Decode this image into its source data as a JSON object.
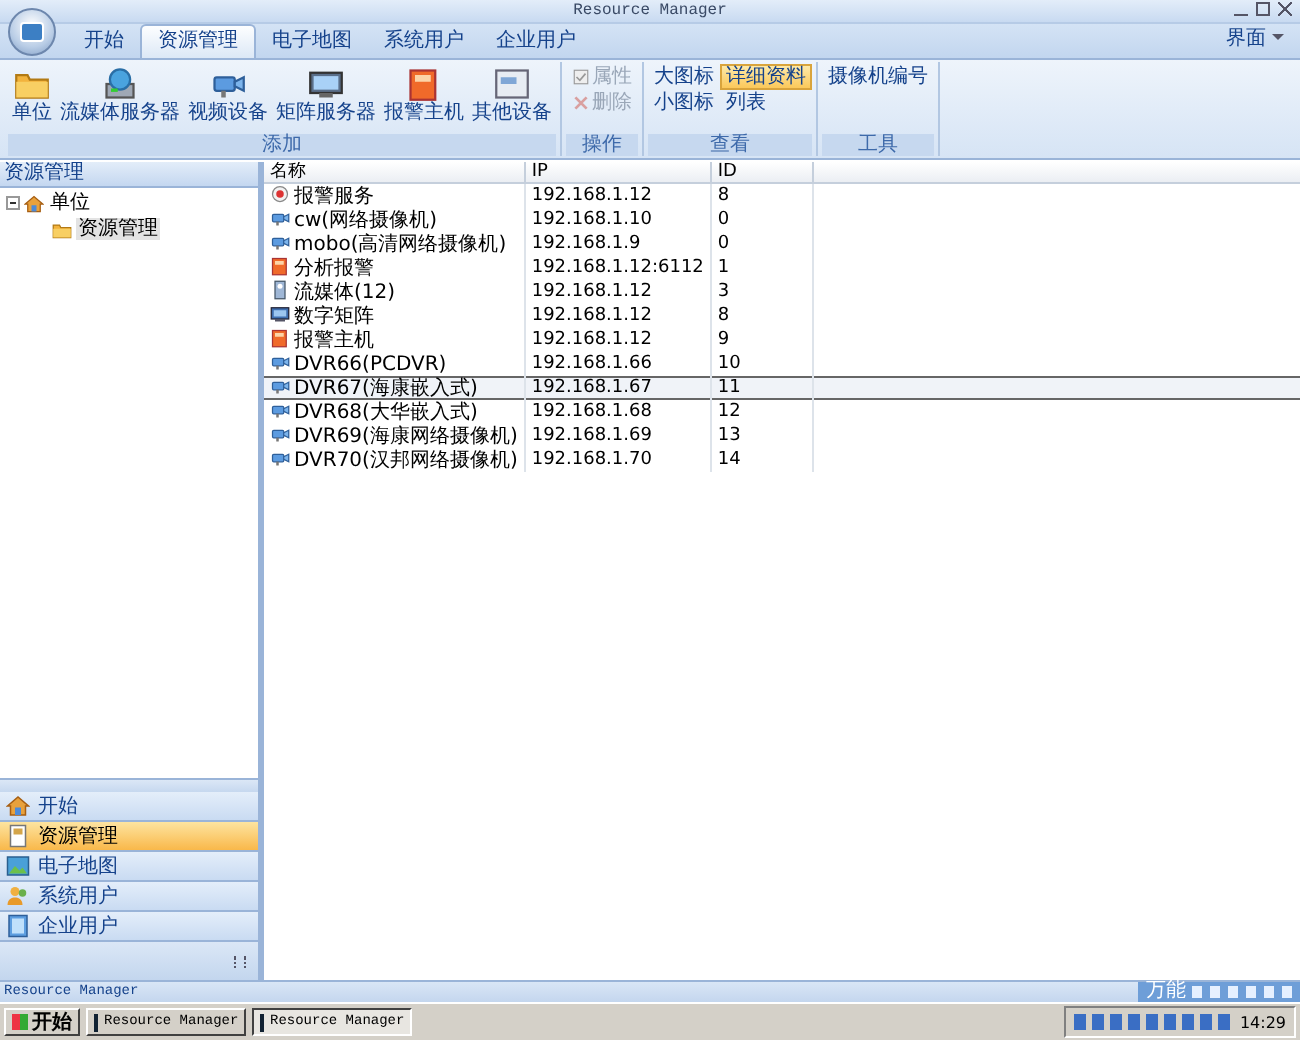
{
  "window": {
    "title": "Resource Manager"
  },
  "tabs": [
    {
      "label": "开始",
      "selected": false
    },
    {
      "label": "资源管理",
      "selected": true
    },
    {
      "label": "电子地图",
      "selected": false
    },
    {
      "label": "系统用户",
      "selected": false
    },
    {
      "label": "企业用户",
      "selected": false
    }
  ],
  "interface_menu": "界面",
  "ribbon": [
    {
      "label": "添加",
      "items": [
        {
          "label": "单位",
          "kind": "folder",
          "disabled": false,
          "selected": false
        },
        {
          "label": "流媒体服务器",
          "kind": "server",
          "disabled": false,
          "selected": false
        },
        {
          "label": "视频设备",
          "kind": "camera",
          "disabled": false,
          "selected": false
        },
        {
          "label": "矩阵服务器",
          "kind": "monitor",
          "disabled": false,
          "selected": false
        },
        {
          "label": "报警主机",
          "kind": "alarm",
          "disabled": false,
          "selected": false
        },
        {
          "label": "其他设备",
          "kind": "device",
          "disabled": false,
          "selected": false
        }
      ]
    },
    {
      "label": "操作",
      "small": [
        {
          "label": "属性",
          "kind": "check",
          "disabled": true,
          "selected": false
        },
        {
          "label": "删除",
          "kind": "cross",
          "disabled": true,
          "selected": false
        }
      ]
    },
    {
      "label": "查看",
      "small": [
        {
          "label": "大图标",
          "disabled": false,
          "selected": false
        },
        {
          "label": "详细资料",
          "disabled": false,
          "selected": true
        },
        {
          "label": "小图标",
          "disabled": false,
          "selected": false
        },
        {
          "label": "列表",
          "disabled": false,
          "selected": false
        }
      ]
    },
    {
      "label": "工具",
      "small": [
        {
          "label": "摄像机编号",
          "disabled": false,
          "selected": false
        }
      ]
    }
  ],
  "sidebar": {
    "title": "资源管理",
    "tree": [
      {
        "label": "单位",
        "kind": "home",
        "selected": false,
        "expanded": true,
        "children": [
          {
            "label": "资源管理",
            "kind": "folder",
            "selected": true
          }
        ]
      }
    ],
    "nav": [
      {
        "label": "开始",
        "kind": "home",
        "selected": false
      },
      {
        "label": "资源管理",
        "kind": "doc",
        "selected": true
      },
      {
        "label": "电子地图",
        "kind": "map",
        "selected": false
      },
      {
        "label": "系统用户",
        "kind": "users",
        "selected": false
      },
      {
        "label": "企业用户",
        "kind": "user",
        "selected": false
      }
    ]
  },
  "table": {
    "columns": [
      "名称",
      "IP",
      "ID"
    ],
    "rows": [
      {
        "kind": "alarm-service",
        "name": "报警服务",
        "ip": "192.168.1.12",
        "id": "8",
        "selected": false
      },
      {
        "kind": "camera",
        "name": "cw(网络摄像机)",
        "ip": "192.168.1.10",
        "id": "0",
        "selected": false
      },
      {
        "kind": "camera",
        "name": "mobo(高清网络摄像机)",
        "ip": "192.168.1.9",
        "id": "0",
        "selected": false
      },
      {
        "kind": "alarm",
        "name": "分析报警",
        "ip": "192.168.1.12:6112",
        "id": "1",
        "selected": false
      },
      {
        "kind": "stream",
        "name": "流媒体(12)",
        "ip": "192.168.1.12",
        "id": "3",
        "selected": false
      },
      {
        "kind": "matrix",
        "name": "数字矩阵",
        "ip": "192.168.1.12",
        "id": "8",
        "selected": false
      },
      {
        "kind": "alarm",
        "name": "报警主机",
        "ip": "192.168.1.12",
        "id": "9",
        "selected": false
      },
      {
        "kind": "camera",
        "name": "DVR66(PCDVR)",
        "ip": "192.168.1.66",
        "id": "10",
        "selected": false
      },
      {
        "kind": "camera",
        "name": "DVR67(海康嵌入式)",
        "ip": "192.168.1.67",
        "id": "11",
        "selected": true
      },
      {
        "kind": "camera",
        "name": "DVR68(大华嵌入式)",
        "ip": "192.168.1.68",
        "id": "12",
        "selected": false
      },
      {
        "kind": "camera",
        "name": "DVR69(海康网络摄像机)",
        "ip": "192.168.1.69",
        "id": "13",
        "selected": false
      },
      {
        "kind": "camera",
        "name": "DVR70(汉邦网络摄像机)",
        "ip": "192.168.1.70",
        "id": "14",
        "selected": false
      }
    ]
  },
  "status_bar": {
    "text": "Resource Manager",
    "ime": "万能"
  },
  "taskbar": {
    "start": "开始",
    "tasks": [
      {
        "label": "Resource Manager",
        "selected": false
      },
      {
        "label": "Resource Manager",
        "selected": true
      }
    ],
    "clock": "14:29"
  }
}
